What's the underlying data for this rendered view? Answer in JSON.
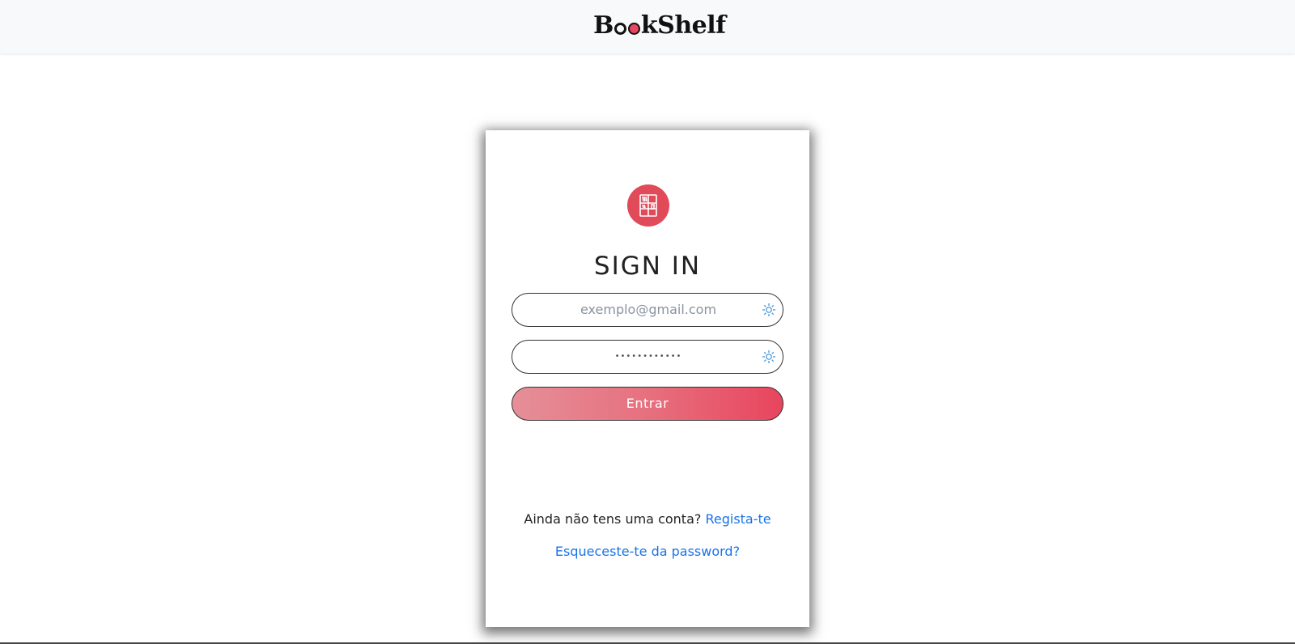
{
  "app": {
    "brand_parts": [
      "B",
      "k",
      "Shelf"
    ]
  },
  "login": {
    "title": "SIGN IN",
    "email_placeholder": "exemplo@gmail.com",
    "password_masked": "••••••••••••",
    "submit_label": "Entrar",
    "register_prompt": "Ainda não tens uma conta?",
    "register_link": "Regista-te",
    "forgot_link": "Esqueceste-te da password?"
  },
  "icons": {
    "logo": "bookshelf-icon",
    "field_indicator": "sparkle-icon"
  },
  "colors": {
    "accent": "#e04a59",
    "link": "#1a73e8",
    "button_gradient_start": "#e58f98",
    "button_gradient_end": "#e8455e"
  }
}
